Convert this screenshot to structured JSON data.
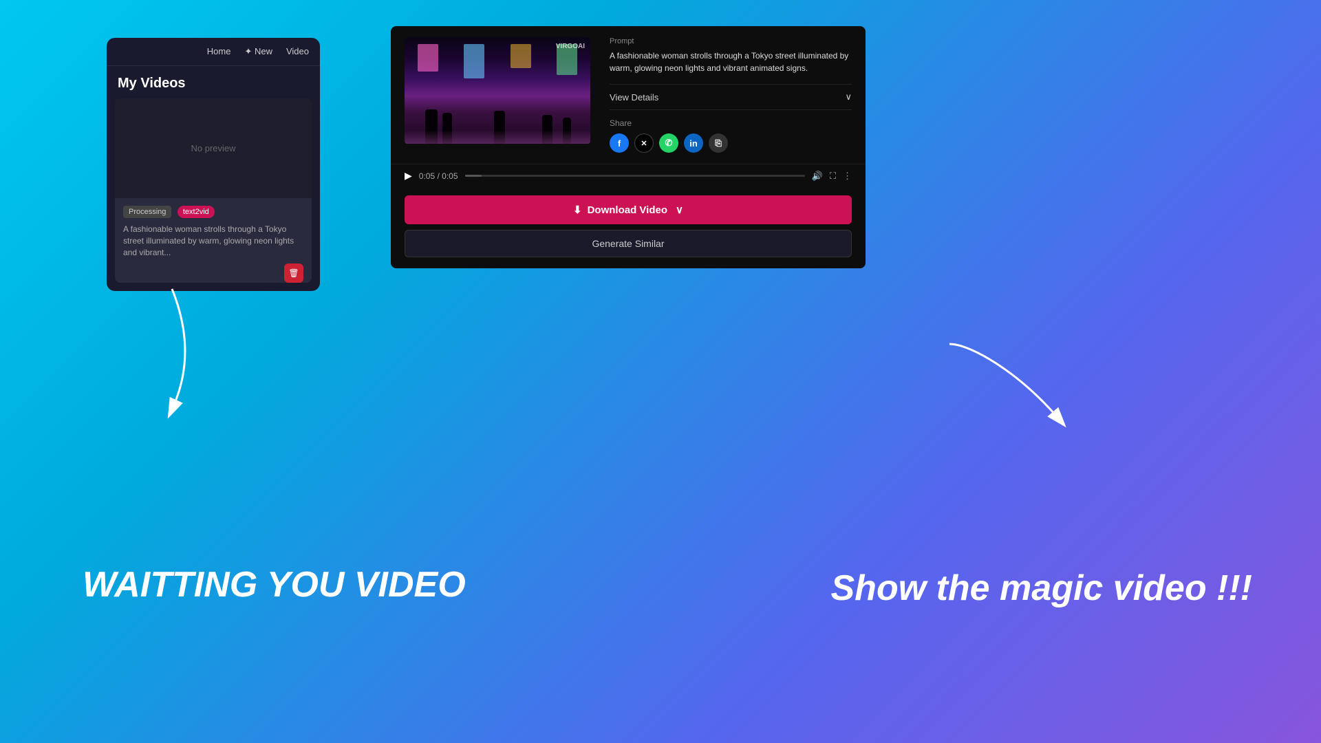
{
  "leftPanel": {
    "nav": {
      "home": "Home",
      "new": "✦ New",
      "video": "Video"
    },
    "title": "My Videos",
    "card": {
      "preview_text": "No preview",
      "status_badge": "Processing",
      "type_badge": "text2vid",
      "description": "A fashionable woman strolls through a Tokyo street illuminated by warm, glowing neon lights and vibrant..."
    }
  },
  "rightPanel": {
    "prompt_label": "Prompt",
    "prompt_text": "A fashionable woman strolls through a Tokyo street illuminated by warm, glowing neon lights and vibrant animated signs.",
    "view_details": "View Details",
    "share_label": "Share",
    "share_icons": [
      "Facebook",
      "X",
      "WhatsApp",
      "LinkedIn",
      "Copy"
    ],
    "video_watermark": "VIRGOAI",
    "controls": {
      "time": "0:05 / 0:05"
    },
    "download_btn": "Download Video",
    "generate_btn": "Generate Similar"
  },
  "annotations": {
    "left_label": "WAITTING YOU VIDEO",
    "right_label": "Show the magic video !!!"
  }
}
